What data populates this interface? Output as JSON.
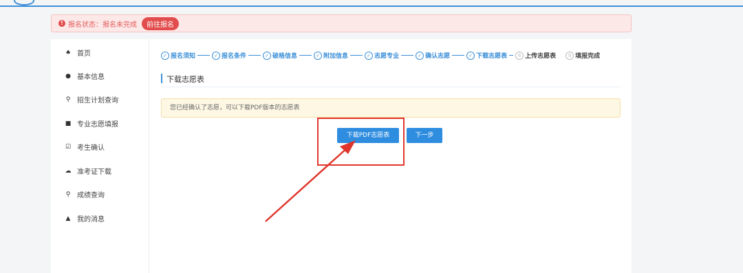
{
  "alert": {
    "icon": "exclamation-icon",
    "text": "报名状态：报名未完成",
    "button": "前往报名"
  },
  "sidebar": {
    "items": [
      {
        "label": "首页",
        "icon": "home-icon",
        "glyph": "♠"
      },
      {
        "label": "基本信息",
        "icon": "user-icon",
        "glyph": "●"
      },
      {
        "label": "招生计划查询",
        "icon": "search-icon",
        "glyph": "⚲"
      },
      {
        "label": "专业志愿填报",
        "icon": "form-icon",
        "glyph": "■"
      },
      {
        "label": "考生确认",
        "icon": "checkbox-icon",
        "glyph": "☑"
      },
      {
        "label": "准考证下载",
        "icon": "cloud-download-icon",
        "glyph": "☁"
      },
      {
        "label": "成绩查询",
        "icon": "search-icon",
        "glyph": "⚲"
      },
      {
        "label": "我的消息",
        "icon": "bell-icon",
        "glyph": "▲"
      }
    ]
  },
  "steps": [
    {
      "label": "报名须知",
      "mark": "✓",
      "done": true
    },
    {
      "label": "报名条件",
      "mark": "✓",
      "done": true
    },
    {
      "label": "破格信息",
      "mark": "✓",
      "done": true
    },
    {
      "label": "附加信息",
      "mark": "✓",
      "done": true
    },
    {
      "label": "志愿专业",
      "mark": "✓",
      "done": true
    },
    {
      "label": "确认志愿",
      "mark": "✓",
      "done": true
    },
    {
      "label": "下载志愿表",
      "mark": "✓",
      "done": true
    },
    {
      "label": "上传志愿表",
      "mark": "8",
      "done": false
    },
    {
      "label": "填报完成",
      "mark": "9",
      "done": false
    }
  ],
  "section": {
    "title": "下载志愿表"
  },
  "notice": {
    "text": "您已经确认了志愿，可以下载PDF版本的志愿表"
  },
  "buttons": {
    "download": "下载PDF志愿表",
    "next": "下一步"
  },
  "colors": {
    "accent": "#2f8de0",
    "alert": "#e24c4c",
    "annotation": "#e0352b"
  }
}
